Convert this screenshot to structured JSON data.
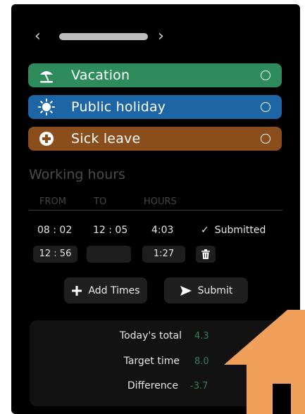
{
  "nav": {
    "prev_icon": "chevron-left-icon",
    "next_icon": "chevron-right-icon"
  },
  "categories": [
    {
      "label": "Vacation",
      "icon": "beach-umbrella-icon",
      "color": "#2e8b5b",
      "selected": false
    },
    {
      "label": "Public holiday",
      "icon": "sun-icon",
      "color": "#1d66a6",
      "selected": false
    },
    {
      "label": "Sick leave",
      "icon": "medical-cross-icon",
      "color": "#8a4e1c",
      "selected": false
    }
  ],
  "working_hours": {
    "title": "Working hours",
    "columns": {
      "from": "FROM",
      "to": "TO",
      "hours": "HOURS"
    },
    "rows": [
      {
        "from": "08 : 02",
        "to": "12 : 05",
        "hours": "4:03",
        "status": "Submitted"
      },
      {
        "from": "12 : 56",
        "to": "",
        "hours": "1:27"
      }
    ]
  },
  "actions": {
    "add_label": "Add Times",
    "submit_label": "Submit"
  },
  "summary": {
    "todays_total_label": "Today's total",
    "todays_total_value": "4.3",
    "target_label": "Target time",
    "target_value": "8.0",
    "difference_label": "Difference",
    "difference_value": "-3.7"
  },
  "colors": {
    "accent_green": "#2f7f58",
    "home_orange": "#f0a05a"
  }
}
